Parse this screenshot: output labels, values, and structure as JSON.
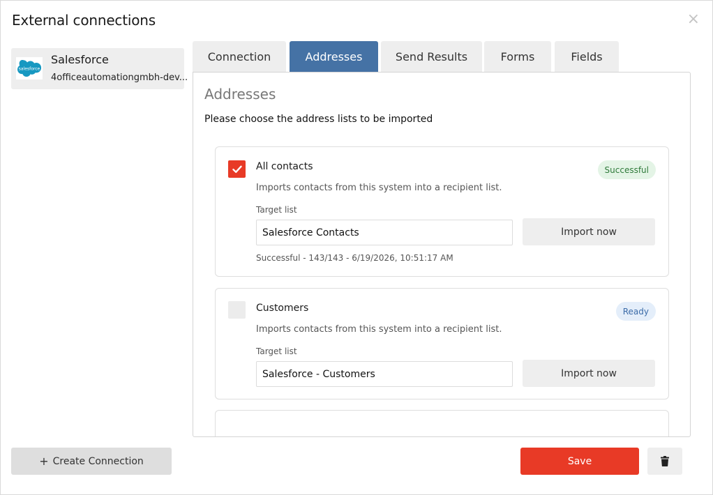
{
  "dialog": {
    "title": "External connections",
    "close_icon": "×"
  },
  "sidebar": {
    "connection": {
      "name": "Salesforce",
      "subtitle": "4officeautomationgmbh-dev...",
      "logo_icon": "salesforce-logo",
      "logo_color": "#1798c1"
    }
  },
  "tabs": [
    {
      "label": "Connection",
      "active": false
    },
    {
      "label": "Addresses",
      "active": true
    },
    {
      "label": "Send Results",
      "active": false
    },
    {
      "label": "Forms",
      "active": false
    },
    {
      "label": "Fields",
      "active": false
    }
  ],
  "addresses": {
    "title": "Addresses",
    "description": "Please choose the address lists to be imported",
    "lists": [
      {
        "title": "All contacts",
        "checked": true,
        "badge": "Successful",
        "description": "Imports contacts from this system into a recipient list.",
        "target_label": "Target list",
        "target_value": "Salesforce Contacts",
        "import_label": "Import now",
        "status": "Successful - 143/143 - 6/19/2026, 10:51:17 AM"
      },
      {
        "title": "Customers",
        "checked": false,
        "badge": "Ready",
        "description": "Imports contacts from this system into a recipient list.",
        "target_label": "Target list",
        "target_value": "Salesforce - Customers",
        "import_label": "Import now"
      }
    ]
  },
  "footer": {
    "create_label": "Create Connection",
    "create_icon": "+",
    "save_label": "Save",
    "delete_icon": "trash-icon"
  },
  "colors": {
    "accent": "#e83a26",
    "tab_active": "#4572a5",
    "success_badge_bg": "#e4f4e6",
    "ready_badge_bg": "#e4eefa"
  }
}
